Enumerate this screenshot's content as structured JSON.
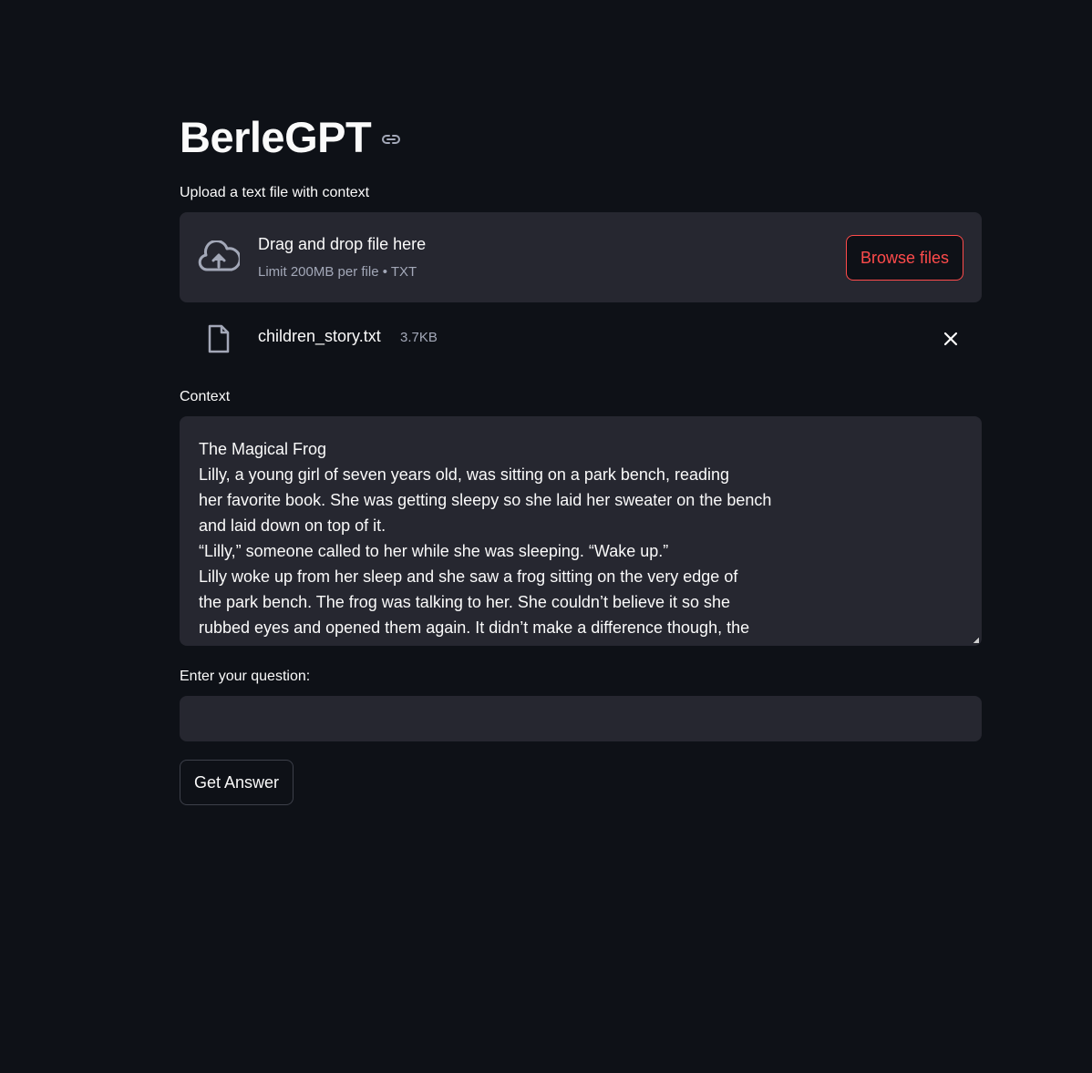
{
  "app": {
    "title": "BerleGPT"
  },
  "uploader": {
    "label": "Upload a text file with context",
    "drag_title": "Drag and drop file here",
    "limit_text": "Limit 200MB per file • TXT",
    "browse_label": "Browse files",
    "icon": "cloud-upload-icon"
  },
  "uploaded_file": {
    "name": "children_story.txt",
    "size": "3.7KB",
    "icon": "file-icon"
  },
  "context": {
    "label": "Context",
    "value": "The Magical Frog\nLilly, a young girl of seven years old, was sitting on a park bench, reading\nher favorite book. She was getting sleepy so she laid her sweater on the bench\nand laid down on top of it.\n“Lilly,” someone called to her while she was sleeping. “Wake up.”\nLilly woke up from her sleep and she saw a frog sitting on the very edge of\nthe park bench. The frog was talking to her. She couldn’t believe it so she\nrubbed eyes and opened them again. It didn’t make a difference though, the"
  },
  "question": {
    "label": "Enter your question:",
    "value": ""
  },
  "actions": {
    "get_answer_label": "Get Answer"
  },
  "colors": {
    "background": "#0e1117",
    "surface": "#262730",
    "accent": "#ff4b4b",
    "text": "#fafafa",
    "muted": "#a3a8b8"
  }
}
